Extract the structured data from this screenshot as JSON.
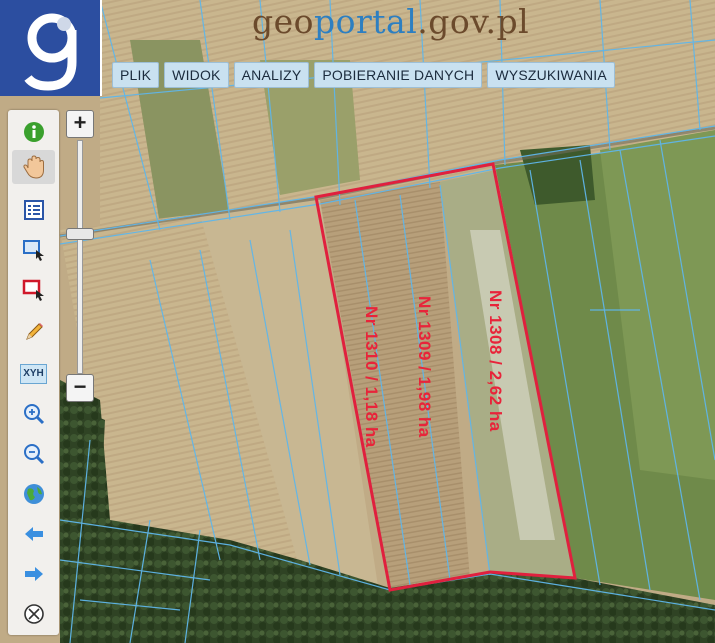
{
  "site": {
    "title_g": "g",
    "title_eo": "eo",
    "title_portal": "portal",
    "title_domain": ".gov.pl"
  },
  "menu": [
    {
      "label": "PLIK"
    },
    {
      "label": "WIDOK"
    },
    {
      "label": "ANALIZY"
    },
    {
      "label": "POBIERANIE DANYCH"
    },
    {
      "label": "WYSZUKIWANIA"
    }
  ],
  "zoom": {
    "plus": "+",
    "minus": "−",
    "level_fraction": 0.4
  },
  "tools": {
    "info": "info-icon",
    "pan": "hand-icon",
    "legend": "legend-icon",
    "select": "select-icon",
    "select_red": "select-red-icon",
    "measure": "pencil-icon",
    "xyh": "XYH",
    "zoom_in": "zoom-in-icon",
    "zoom_out": "zoom-out-icon",
    "globe": "globe-icon",
    "back": "arrow-left-icon",
    "forward": "arrow-right-icon",
    "clear": "clear-icon"
  },
  "parcels": [
    {
      "label": "Nr 1310 / 1,18 ha"
    },
    {
      "label": "Nr 1309 / 1,98 ha"
    },
    {
      "label": "Nr 1308 / 2,62 ha"
    }
  ],
  "colors": {
    "parcel_outline": "#e0203e",
    "parcel_lines": "#5fb6ea",
    "logo_bg": "#2c4ea0",
    "menu_bg": "#c9e1f0"
  }
}
